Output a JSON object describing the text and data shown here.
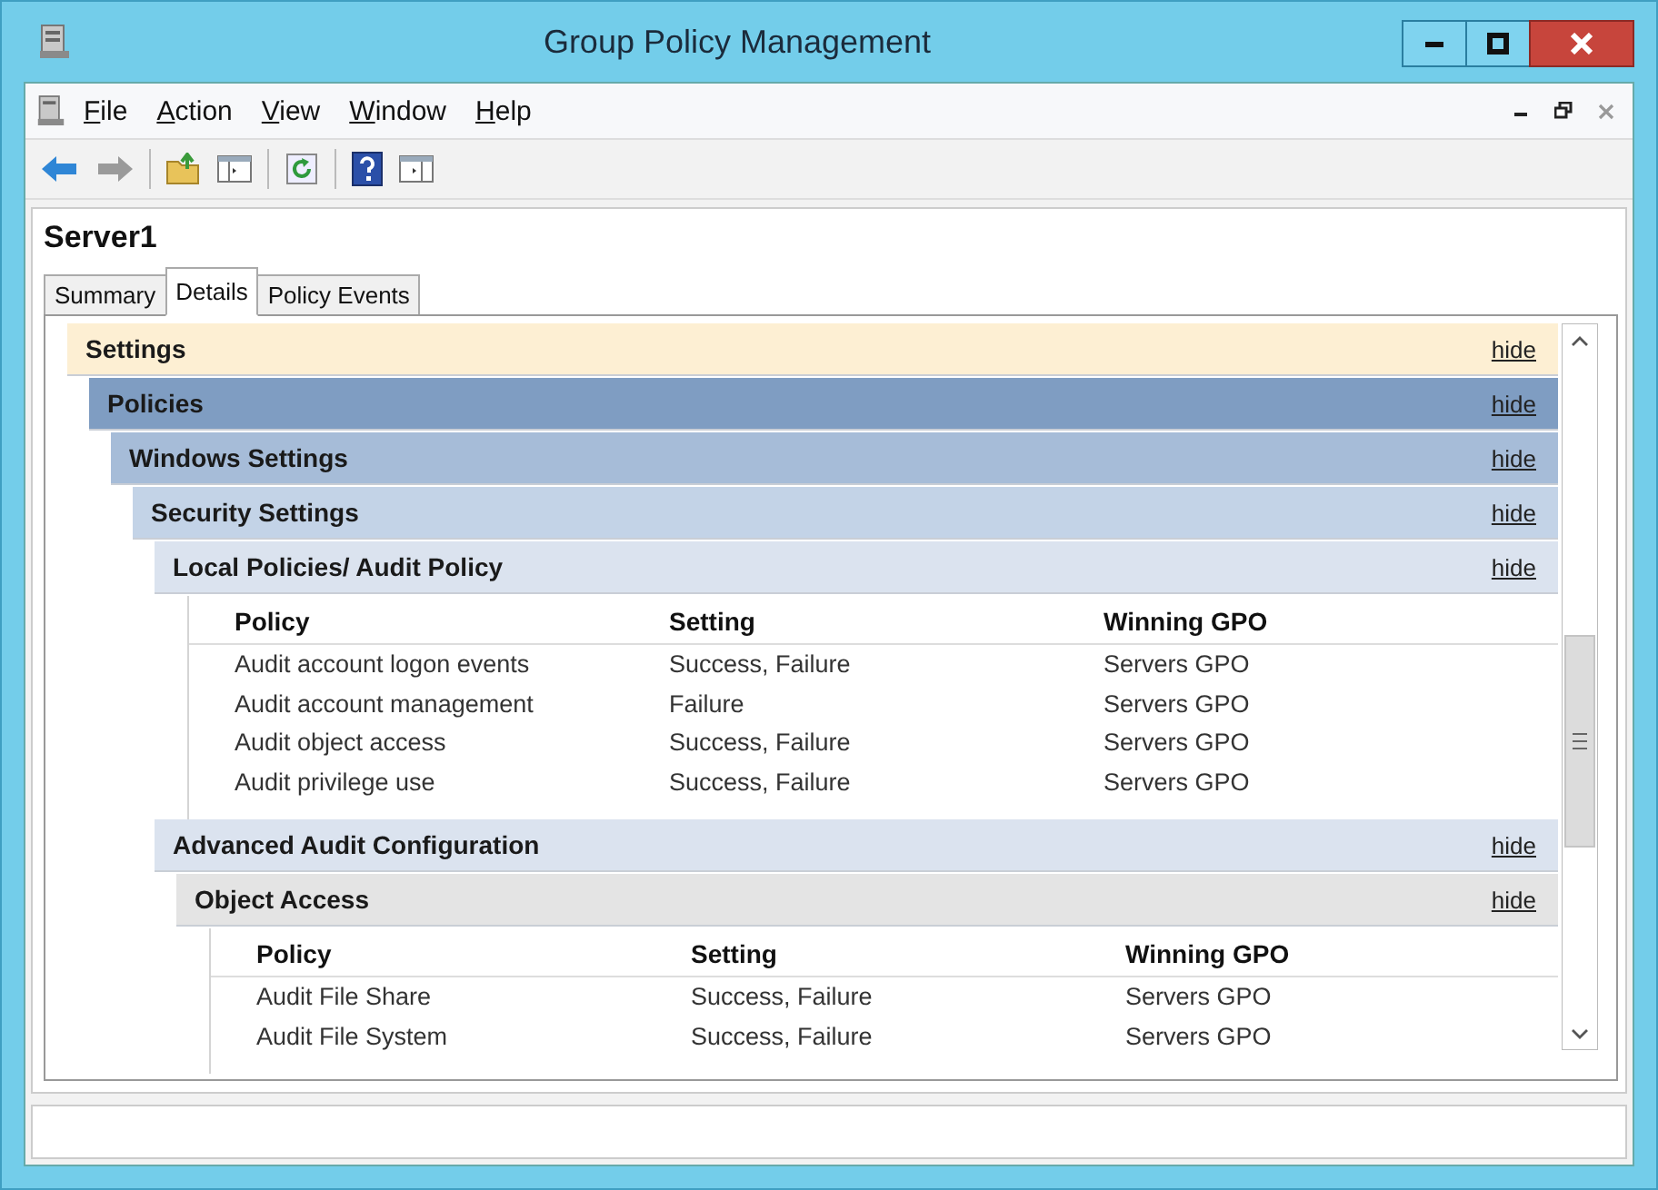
{
  "window": {
    "title": "Group Policy Management"
  },
  "menu": [
    "File",
    "Action",
    "View",
    "Window",
    "Help"
  ],
  "toolbar": [
    {
      "kind": "back",
      "disabled": false
    },
    {
      "kind": "forward",
      "disabled": true
    },
    {
      "kind": "separator"
    },
    {
      "kind": "up-folder",
      "disabled": false
    },
    {
      "kind": "console-tree",
      "disabled": false
    },
    {
      "kind": "separator"
    },
    {
      "kind": "refresh",
      "disabled": false
    },
    {
      "kind": "separator"
    },
    {
      "kind": "help",
      "disabled": false
    },
    {
      "kind": "action-pane",
      "disabled": false
    }
  ],
  "heading": "Server1",
  "tabs": [
    {
      "label": "Summary",
      "selected": false
    },
    {
      "label": "Details",
      "selected": true
    },
    {
      "label": "Policy Events",
      "selected": false
    }
  ],
  "report": {
    "sections": [
      {
        "title": "Settings",
        "hide": "hide",
        "children": [
          {
            "title": "Policies",
            "hide": "hide",
            "children": [
              {
                "title": "Windows Settings",
                "hide": "hide",
                "children": [
                  {
                    "title": "Security Settings",
                    "hide": "hide",
                    "children": [
                      {
                        "title": "Local Policies/ Audit Policy",
                        "hide": "hide",
                        "table": {
                          "columns": [
                            "Policy",
                            "Setting",
                            "Winning GPO"
                          ],
                          "rows": [
                            [
                              "Audit account logon events",
                              "Success, Failure",
                              "Servers GPO"
                            ],
                            [
                              "Audit account management",
                              "Failure",
                              "Servers GPO"
                            ],
                            [
                              "Audit object access",
                              "Success, Failure",
                              "Servers GPO"
                            ],
                            [
                              "Audit privilege use",
                              "Success, Failure",
                              "Servers GPO"
                            ]
                          ]
                        }
                      },
                      {
                        "title": "Advanced Audit Configuration",
                        "hide": "hide",
                        "children": [
                          {
                            "title": "Object Access",
                            "hide": "hide",
                            "table": {
                              "columns": [
                                "Policy",
                                "Setting",
                                "Winning GPO"
                              ],
                              "rows": [
                                [
                                  "Audit File Share",
                                  "Success, Failure",
                                  "Servers GPO"
                                ],
                                [
                                  "Audit File System",
                                  "Success, Failure",
                                  "Servers GPO"
                                ]
                              ]
                            }
                          }
                        ]
                      }
                    ]
                  }
                ]
              }
            ]
          }
        ]
      }
    ]
  }
}
